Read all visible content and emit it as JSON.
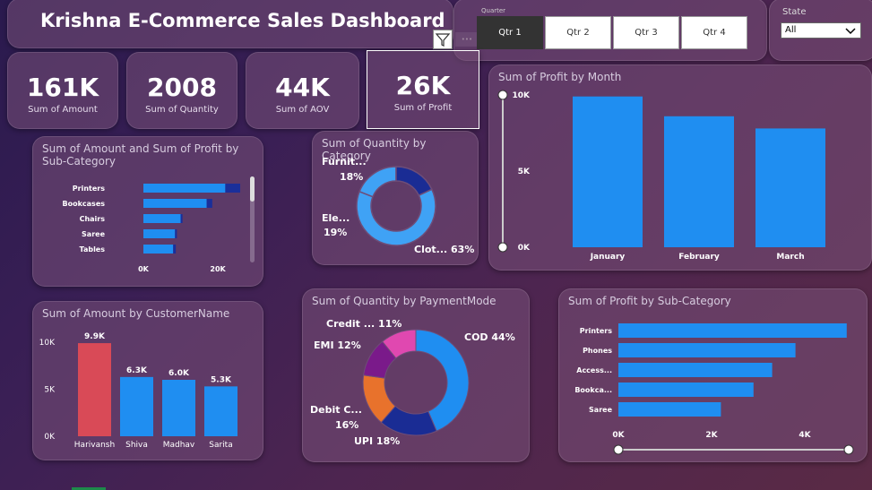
{
  "header": {
    "title": "Krishna E-Commerce Sales Dashboard"
  },
  "quarter_slicer": {
    "label": "Quarter",
    "options": [
      "Qtr 1",
      "Qtr 2",
      "Qtr 3",
      "Qtr 4"
    ],
    "selected": "Qtr 1",
    "more_icon": "•••"
  },
  "state_slicer": {
    "label": "State",
    "value": "All"
  },
  "kpis": [
    {
      "value": "161K",
      "label": "Sum of Amount"
    },
    {
      "value": "2008",
      "label": "Sum of Quantity"
    },
    {
      "value": "44K",
      "label": "Sum of AOV"
    },
    {
      "value": "26K",
      "label": "Sum of Profit"
    }
  ],
  "colors": {
    "bar_blue": "#1f8ef1",
    "bar_dark": "#1a2f9a",
    "highlight_red": "#d94a57",
    "donut_light": "#3fa2f5",
    "donut_dark": "#1a2c94",
    "pay_cod": "#1f8ef1",
    "pay_upi": "#1a2c94",
    "pay_debit": "#e8722c",
    "pay_emi": "#7a1a8a",
    "pay_credit": "#e048b0"
  },
  "chart_data": [
    {
      "id": "amount_profit_subcat",
      "type": "bar",
      "orientation": "horizontal",
      "title": "Sum of Amount and Sum of Profit by Sub-Category",
      "categories": [
        "Printers",
        "Bookcases",
        "Chairs",
        "Saree",
        "Tables"
      ],
      "series": [
        {
          "values": [
            22000,
            17000,
            10000,
            8500,
            8000
          ]
        },
        {
          "values": [
            4000,
            1500,
            500,
            500,
            700
          ]
        }
      ],
      "xlim": [
        0,
        26000
      ],
      "x_ticks": [
        "0K",
        "20K"
      ],
      "stacked": true
    },
    {
      "id": "qty_category",
      "type": "pie",
      "donut": true,
      "title": "Sum of Quantity by Category",
      "slices": [
        {
          "label": "Clot...",
          "value": 63,
          "pct": "63%"
        },
        {
          "label": "Ele...",
          "value": 19,
          "pct": "19%"
        },
        {
          "label": "Furnit...",
          "value": 18,
          "pct": "18%"
        }
      ]
    },
    {
      "id": "profit_month",
      "type": "bar",
      "title": "Sum of Profit by Month",
      "categories": [
        "January",
        "February",
        "March"
      ],
      "values": [
        9900,
        8600,
        7800
      ],
      "ylim": [
        0,
        10000
      ],
      "y_ticks": [
        "0K",
        "5K",
        "10K"
      ]
    },
    {
      "id": "amount_customer",
      "type": "bar",
      "title": "Sum of Amount by CustomerName",
      "categories": [
        "Harivansh",
        "Shiva",
        "Madhav",
        "Sarita"
      ],
      "values": [
        9900,
        6300,
        6000,
        5300
      ],
      "data_labels": [
        "9.9K",
        "6.3K",
        "6.0K",
        "5.3K"
      ],
      "ylim": [
        0,
        10000
      ],
      "y_ticks": [
        "0K",
        "5K",
        "10K"
      ]
    },
    {
      "id": "qty_payment",
      "type": "pie",
      "donut": true,
      "title": "Sum of Quantity by PaymentMode",
      "slices": [
        {
          "label": "COD",
          "value": 44,
          "pct": "44%"
        },
        {
          "label": "UPI",
          "value": 18,
          "pct": "18%"
        },
        {
          "label": "Debit C...",
          "value": 16,
          "pct": "16%"
        },
        {
          "label": "EMI",
          "value": 12,
          "pct": "12%"
        },
        {
          "label": "Credit ...",
          "value": 11,
          "pct": "11%"
        }
      ]
    },
    {
      "id": "profit_subcat",
      "type": "bar",
      "orientation": "horizontal",
      "title": "Sum of Profit by Sub-Category",
      "categories": [
        "Printers",
        "Phones",
        "Access...",
        "Bookca...",
        "Saree"
      ],
      "values": [
        4900,
        3800,
        3300,
        2900,
        2200
      ],
      "xlim": [
        0,
        5000
      ],
      "x_ticks": [
        "0K",
        "2K",
        "4K"
      ]
    }
  ]
}
